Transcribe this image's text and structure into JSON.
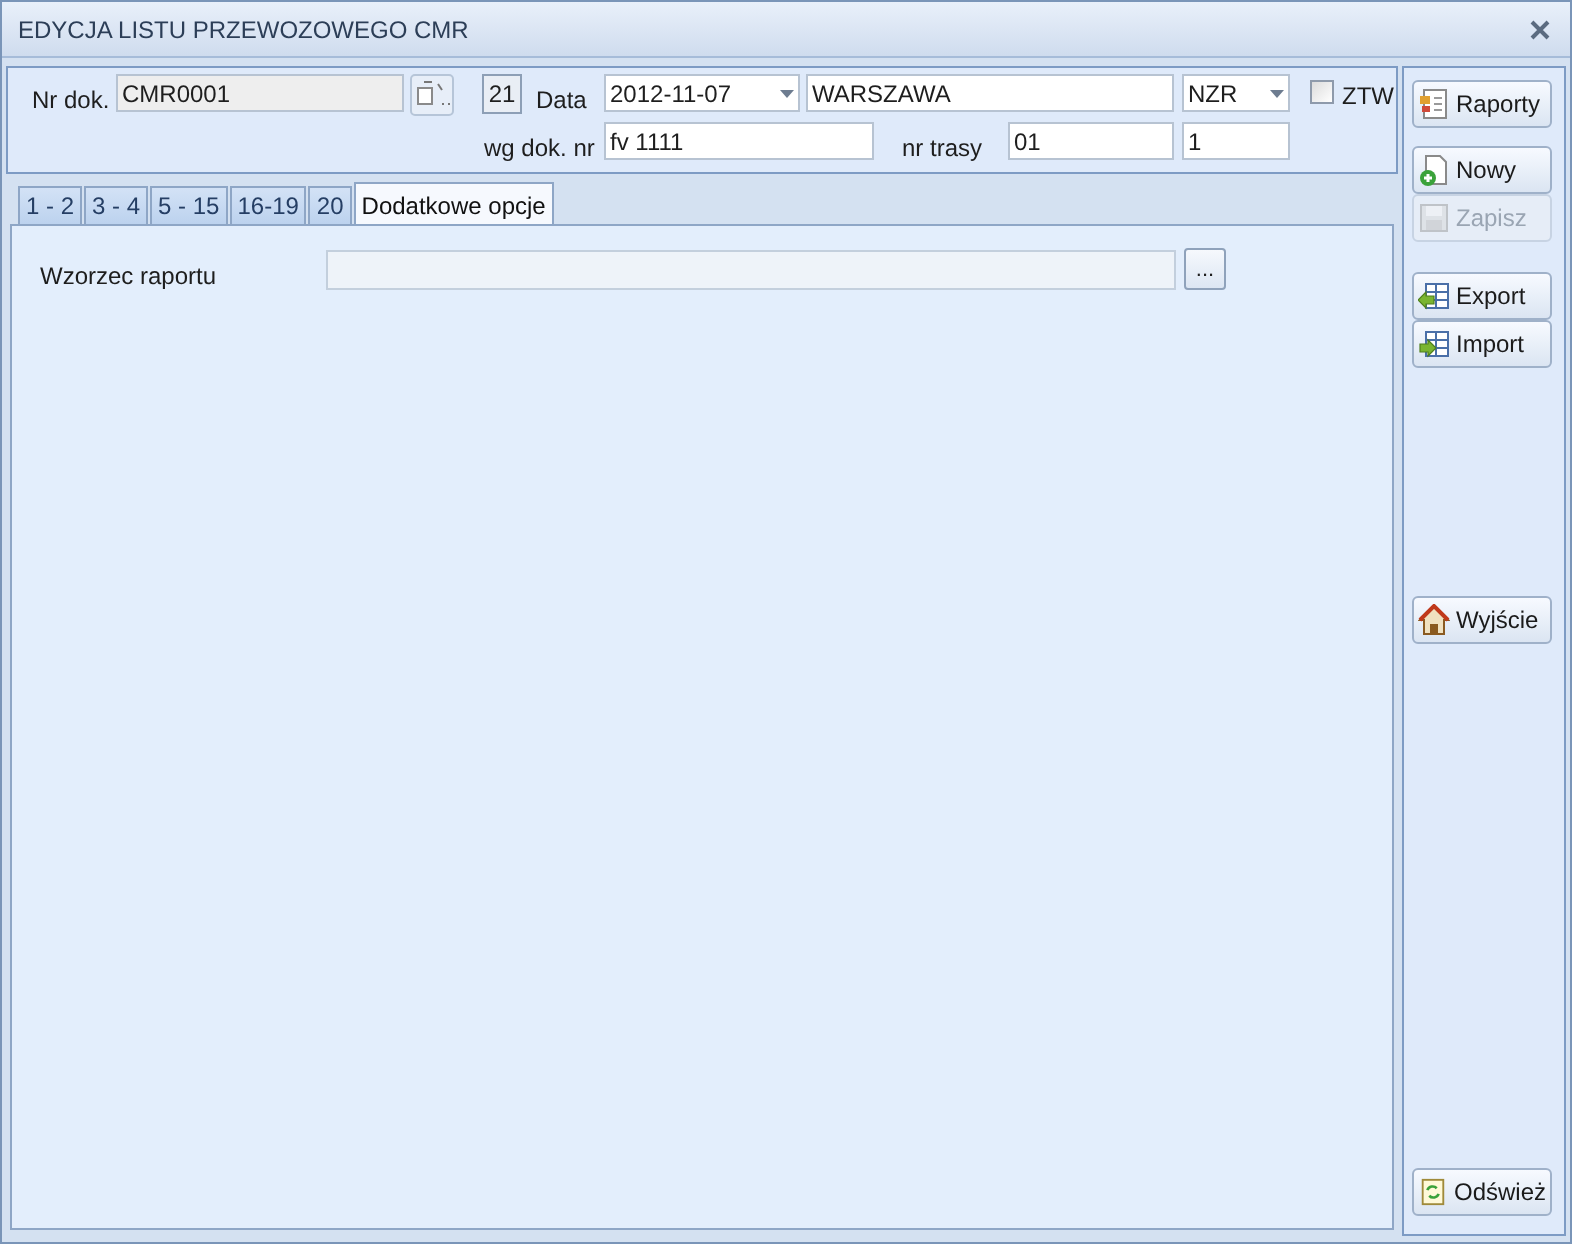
{
  "window": {
    "title": "EDYCJA LISTU PRZEWOZOWEGO CMR"
  },
  "header": {
    "doc_label": "Nr dok.",
    "doc_value": "CMR0001",
    "day_badge": "21",
    "date_label": "Data",
    "date_value": "2012-11-07",
    "city_value": "WARSZAWA",
    "code_value": "NZR",
    "ztw": {
      "label": "ZTW",
      "checked": false
    },
    "ref_label": "wg dok. nr",
    "ref_value": "fv 1111",
    "route_label": "nr trasy",
    "route_value": "01",
    "route_value_2": "1"
  },
  "tabs": [
    {
      "label": "1 - 2",
      "selected": false
    },
    {
      "label": "3 - 4",
      "selected": false
    },
    {
      "label": "5 - 15",
      "selected": false
    },
    {
      "label": "16-19",
      "selected": false
    },
    {
      "label": "20",
      "selected": false
    },
    {
      "label": "Dodatkowe opcje",
      "selected": true
    }
  ],
  "content": {
    "template_label": "Wzorzec raportu",
    "browse_button": "..."
  },
  "buttons": [
    {
      "kind": "report",
      "label": "Raporty",
      "disabled": false
    },
    {
      "kind": "new",
      "label": "Nowy",
      "disabled": false
    },
    {
      "kind": "save",
      "label": "Zapisz",
      "disabled": true
    },
    {
      "kind": "export",
      "label": "Export",
      "disabled": false
    },
    {
      "kind": "import",
      "label": "Import",
      "disabled": false
    },
    {
      "kind": "exit",
      "label": "Wyjście",
      "disabled": false
    },
    {
      "kind": "refresh",
      "label": "Odśwież",
      "disabled": false
    }
  ]
}
